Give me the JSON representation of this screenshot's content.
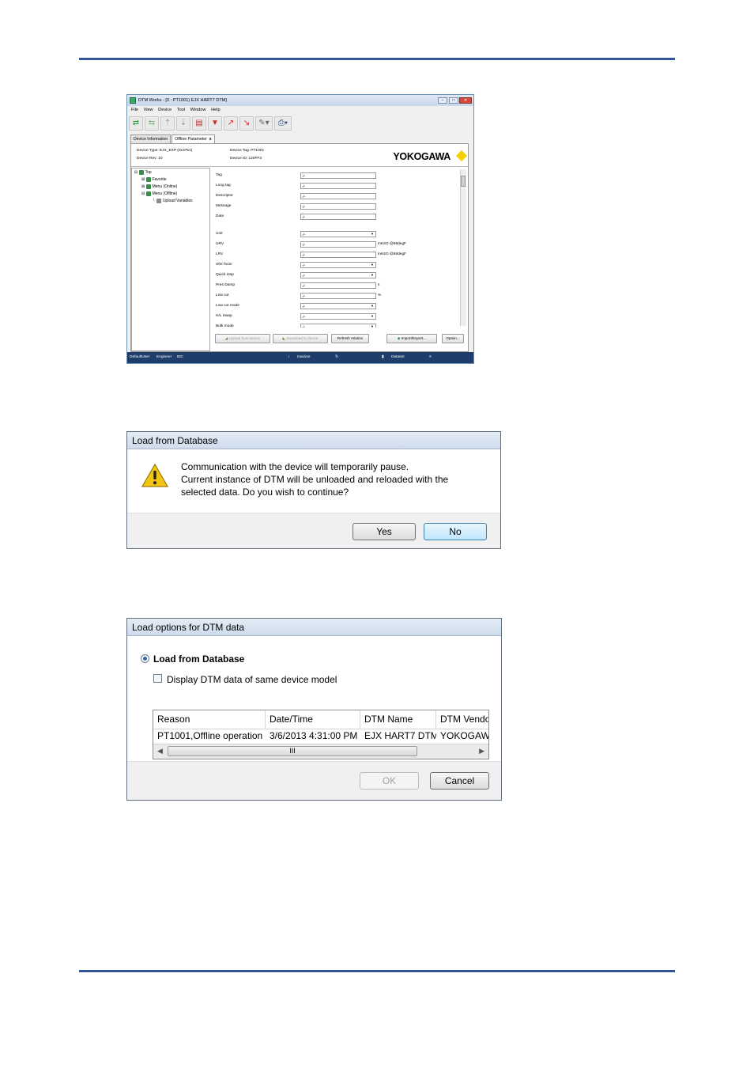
{
  "dtm_window": {
    "title": "DTM Works - [0 : PT1001) EJX HART7 DTM]",
    "menu": [
      "File",
      "View",
      "Device",
      "Tool",
      "Window",
      "Help"
    ],
    "tabs": [
      {
        "label": "Device Information"
      },
      {
        "label": "Offline Parameter"
      }
    ],
    "tab_close": "x",
    "header": {
      "device_type": "Device Type:  EJX_EXP (0x3751)",
      "device_rev": "Device Rev:   10",
      "device_tag": "Device Tag:  PT1001",
      "device_id": "Device ID:   120FF3",
      "logo": "YOKOGAWA"
    },
    "tree": {
      "top": "Top",
      "favorite": "Favorite",
      "menu_online": "Menu (Online)",
      "menu_offline": "Menu (Offline)",
      "upload_variables": "Upload Variables"
    },
    "params": [
      {
        "label": "Tag",
        "value": "-/-",
        "unit": ""
      },
      {
        "label": "Long tag",
        "value": "-/-",
        "unit": ""
      },
      {
        "label": "Descriptor",
        "value": "-/-",
        "unit": ""
      },
      {
        "label": "Message",
        "value": "-/-",
        "unit": ""
      },
      {
        "label": "Date",
        "value": "-/-",
        "unit": ""
      },
      {
        "label": "Unit",
        "value": "-/-",
        "unit": ""
      },
      {
        "label": "URV",
        "value": "-/-",
        "unit": "inH2O @68degF"
      },
      {
        "label": "LRV",
        "value": "-/-",
        "unit": "inH2O @68degF"
      },
      {
        "label": "Xfer fnctn",
        "value": "-/-",
        "unit": ""
      },
      {
        "label": "Quick resp",
        "value": "-/-",
        "unit": ""
      },
      {
        "label": "Pres Damp",
        "value": "-/-",
        "unit": "s"
      },
      {
        "label": "Low cut",
        "value": "-/-",
        "unit": "%"
      },
      {
        "label": "Low cut mode",
        "value": "-/-",
        "unit": ""
      },
      {
        "label": "H/L Swap",
        "value": "-/-",
        "unit": ""
      },
      {
        "label": "Bulk mode",
        "value": "-/-",
        "unit": ""
      }
    ],
    "buttons": {
      "upload": "Upload from device",
      "download": "Download to device",
      "refresh": "Refresh relation",
      "import_export": "Import/Export...",
      "option": "Option..."
    },
    "status": {
      "user": "DefaultUser",
      "role": "Engineer",
      "mode": "BIC",
      "state": "Inactive",
      "dataset": "Dataset"
    }
  },
  "dialog_confirm": {
    "title": "Load from Database",
    "message_lines": [
      "Communication with the device will temporarily pause.",
      "Current instance of DTM will be unloaded and reloaded with the",
      "selected data. Do you wish to continue?"
    ],
    "yes": "Yes",
    "no": "No"
  },
  "dialog_options": {
    "title": "Load options for DTM data",
    "radio_label": "Load from Database",
    "checkbox_label": "Display DTM data of same device model",
    "columns": [
      "Reason",
      "Date/Time",
      "DTM Name",
      "DTM Vendor"
    ],
    "rows": [
      [
        "PT1001,Offline operation",
        "3/6/2013 4:31:00 PM",
        "EJX HART7 DTM",
        "YOKOGAWA"
      ]
    ],
    "scroll_grip": "III",
    "ok": "OK",
    "cancel": "Cancel"
  },
  "colors": {
    "rule": "#2f5597",
    "status_bar": "#1f3d6b",
    "logo_diamond": "#f5cf00"
  }
}
